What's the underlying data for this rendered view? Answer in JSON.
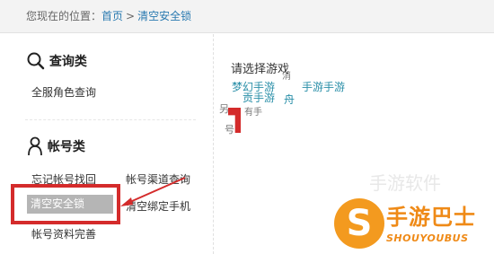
{
  "breadcrumb": {
    "label": "您现在的位置：",
    "home": "首页",
    "separator": ">",
    "current": "清空安全锁"
  },
  "sidebar": {
    "query_section": {
      "title": "查询类",
      "icon": "search-icon",
      "links": [
        "全服角色查询"
      ]
    },
    "account_section": {
      "title": "帐号类",
      "icon": "user-icon",
      "links": [
        "忘记帐号找回",
        "帐号渠道查询",
        "清空安全锁",
        "清空绑定手机",
        "帐号资料完善"
      ]
    }
  },
  "content": {
    "prompt": "请选择游戏",
    "games": [
      "梦幻手游",
      "贡手游"
    ],
    "fragments": [
      "消",
      "手游",
      "手游",
      "舟",
      "另",
      "有手",
      "号",
      "s"
    ]
  },
  "watermark": {
    "brand_text": "手游巴士",
    "brand_sub": "SHOUYOUBUS",
    "faint_text": "手游软件"
  },
  "colors": {
    "link": "#2a7ab0",
    "highlight_red": "#d42b2b",
    "active_bg": "#b5b5b5",
    "brand_orange": "#f39a1f"
  }
}
